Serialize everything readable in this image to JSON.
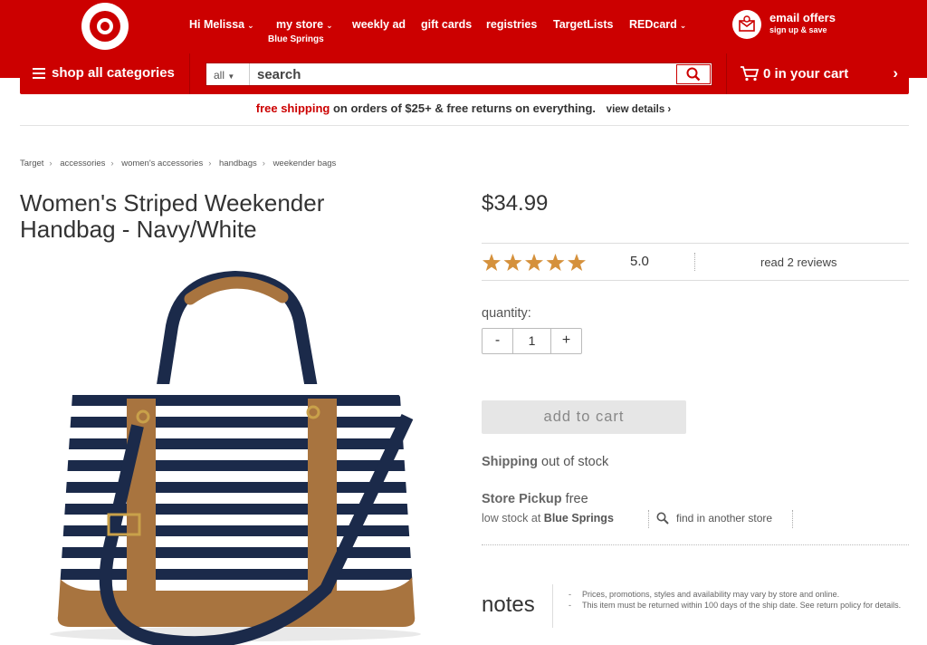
{
  "header": {
    "greeting": "Hi Melissa",
    "my_store": "my store",
    "store_name": "Blue Springs",
    "weekly_ad": "weekly ad",
    "gift_cards": "gift cards",
    "registries": "registries",
    "target_lists": "TargetLists",
    "redcard": "REDcard",
    "email_title": "email offers",
    "email_sub": "sign up & save",
    "brand_color": "#cc0000"
  },
  "search_bar": {
    "shop_all": "shop all categories",
    "scope": "all",
    "placeholder": "search",
    "cart": "0 in your cart"
  },
  "promo": {
    "highlight": "free shipping",
    "text": "on orders of $25+ & free returns on everything.",
    "details": "view details ›"
  },
  "breadcrumb": [
    "Target",
    "accessories",
    "women's accessories",
    "handbags",
    "weekender bags"
  ],
  "product": {
    "title": "Women's Striped Weekender Handbag - Navy/White",
    "price": "$34.99",
    "rating": 5.0,
    "rating_text": "5.0",
    "reviews_link": "read 2 reviews",
    "quantity_label": "quantity:",
    "quantity_minus": "-",
    "quantity": "1",
    "quantity_plus": "+",
    "add_to_cart": "add to cart",
    "shipping_label": "Shipping",
    "shipping_status": "out of stock",
    "pickup_label": "Store Pickup",
    "pickup_status": "free",
    "low_stock_prefix": "low stock at",
    "low_stock_store": "Blue Springs",
    "find_store": "find in another store",
    "image_icon": "striped-weekender-bag"
  },
  "notes": {
    "title": "notes",
    "items": [
      "Prices, promotions, styles and availability may vary by store and online.",
      "This item must be returned within 100 days of the ship date. See return policy for details."
    ]
  }
}
